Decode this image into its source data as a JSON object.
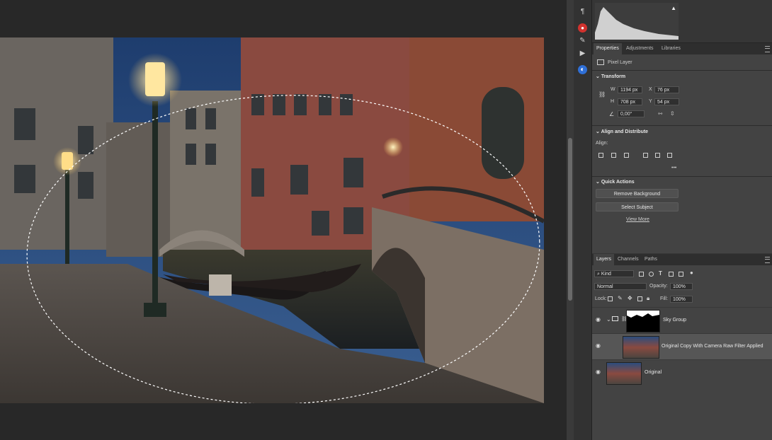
{
  "properties_tabs": [
    {
      "label": "Properties"
    },
    {
      "label": "Adjustments"
    },
    {
      "label": "Libraries"
    }
  ],
  "properties": {
    "layer_type": "Pixel Layer",
    "transform_title": "Transform",
    "w_label": "W",
    "w_value": "1194 px",
    "h_label": "H",
    "h_value": "708 px",
    "x_label": "X",
    "x_value": "76 px",
    "y_label": "Y",
    "y_value": "54 px",
    "angle_value": "0,00°",
    "align_title": "Align and Distribute",
    "align_label": "Align:",
    "more_label": "•••",
    "quick_title": "Quick Actions",
    "remove_bg": "Remove Background",
    "select_subject": "Select Subject",
    "view_more": "View More"
  },
  "layers_tabs": [
    {
      "label": "Layers"
    },
    {
      "label": "Channels"
    },
    {
      "label": "Paths"
    }
  ],
  "layers_panel": {
    "filter_kind": "Kind",
    "blend_mode": "Normal",
    "opacity_label": "Opacity:",
    "opacity_value": "100%",
    "lock_label": "Lock:",
    "fill_label": "Fill:",
    "fill_value": "100%",
    "layers": [
      {
        "name": "Sky Group"
      },
      {
        "name": "Original Copy With Camera Raw Filter Applied"
      },
      {
        "name": "Original"
      }
    ]
  },
  "colors": {
    "panel_bg": "#434343",
    "selected_row": "#565656",
    "app_bg": "#282828"
  }
}
